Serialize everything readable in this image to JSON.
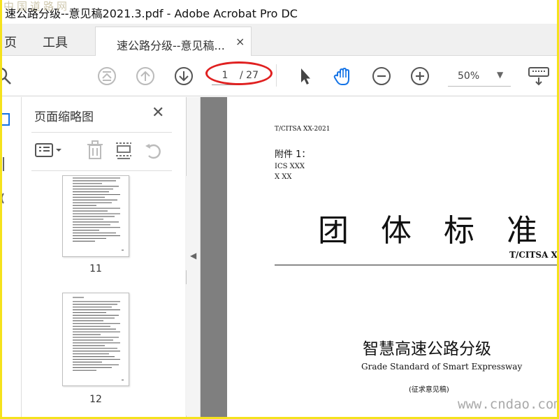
{
  "watermarks": {
    "top_left": "中国道路网",
    "bottom_right": "www.cndao.com"
  },
  "window": {
    "title": "速公路分级--意见稿2021.3.pdf - Adobe Acrobat Pro DC"
  },
  "tabs": {
    "home": "页",
    "tools": "工具",
    "doc": "速公路分级--意见稿...",
    "close": "×"
  },
  "toolbar": {
    "page_current": "1",
    "page_total": "/ 27",
    "zoom": "50%"
  },
  "panel": {
    "title": "页面缩略图",
    "close": "✕",
    "thumbnails": [
      {
        "label": "11"
      },
      {
        "label": "12"
      }
    ]
  },
  "document": {
    "standard_no": "T/CITSA XX-2021",
    "attachment": "附件 1：",
    "ics": "ICS XXX",
    "x_code": "X XX",
    "big_title": "团体标准",
    "code": "T/CITSA X",
    "title_cn": "智慧高速公路分级",
    "title_en": "Grade Standard of Smart Expressway",
    "draft_note": "(征求意见稿)"
  },
  "colors": {
    "accent_blue": "#1473e6",
    "highlight_ring": "#e02020",
    "frame_yellow": "#f5e21c"
  }
}
